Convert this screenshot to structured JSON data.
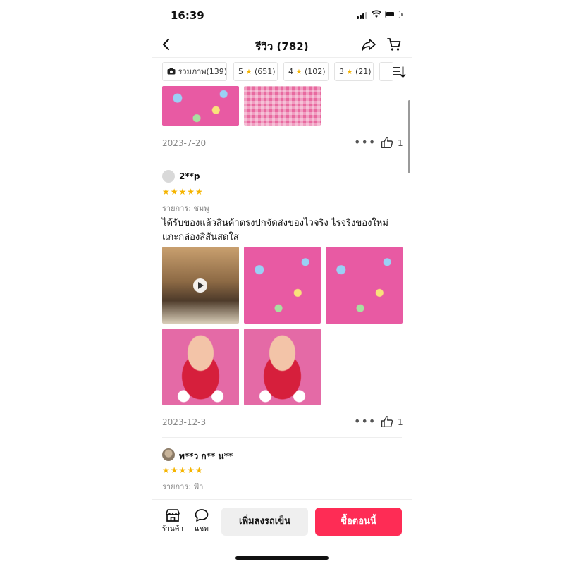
{
  "status": {
    "time": "16:39"
  },
  "header": {
    "title": "รีวิว (782)"
  },
  "filters": [
    {
      "label": "รวมภาพ(139)"
    },
    {
      "stars": "5",
      "count": "(651)"
    },
    {
      "stars": "4",
      "count": "(102)"
    },
    {
      "stars": "3",
      "count": "(21)"
    }
  ],
  "reviews": [
    {
      "date": "2023-7-20",
      "likes": "1"
    },
    {
      "user": "2**p",
      "stars": "★★★★★",
      "variant": "รายการ: ชมพู",
      "text": "ได้รับของแล้วสินค้าตรงปกจัดส่งของไวจริง ไรจริงของใหม่แกะกล่องสีสันสดใส",
      "date": "2023-12-3",
      "likes": "1"
    },
    {
      "user": "พ**ว ก** น**",
      "stars": "★★★★★",
      "variant": "รายการ: ฟ้า"
    }
  ],
  "bottom": {
    "shop_label": "ร้านค้า",
    "chat_label": "แชท",
    "add_cart_label": "เพิ่มลงรถเข็น",
    "buy_label": "ซื้อตอนนี้"
  },
  "colors": {
    "accent": "#fe2c55",
    "star": "#f5b400"
  }
}
